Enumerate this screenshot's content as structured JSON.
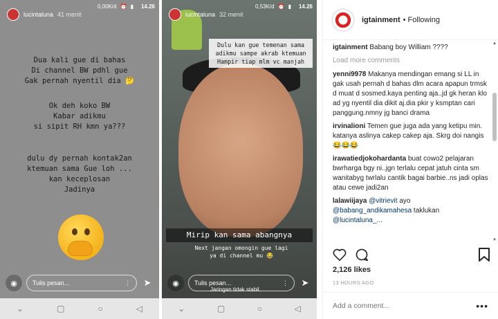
{
  "phone1": {
    "status": {
      "speed": "0,00K/d",
      "time": "14.26"
    },
    "username": "lucintaluna",
    "ago": "41 menit",
    "text_blocks": [
      "Dua kali gue di bahas\nDi channel BW pdhl gue\nGak pernah nyentil dia 🤔",
      "Ok deh koko BW\nKabar adikmu\nsi sipit RH kmn ya???",
      "dulu dy pernah kontak2an\nktemuan sama Gue loh ...\nkan keceplosan\nJadinya"
    ],
    "reply_placeholder": "Tulis pesan..."
  },
  "phone2": {
    "status": {
      "speed": "0,53K/d",
      "time": "14.26"
    },
    "username": "lucintaluna",
    "ago": "32 menit",
    "caption_top": "Dulu kan gue temenan sama\nadikmu sampe akrab ktemuan\nHampir tiap mlm vc manjah",
    "caption_mid": "Mirip kan sama abangnya",
    "caption_low": "Next jangan omongin gue lagi\nya di channel mu 😂",
    "reply_placeholder": "Tulis pesan...",
    "network_note": "Jaringan tidak stabil."
  },
  "instagram": {
    "account": "igtainment",
    "follow_state": "Following",
    "caption": {
      "user": "igtainment",
      "text": "Babang boy William ????"
    },
    "load_more": "Load more comments",
    "comments": [
      {
        "user": "yenni9978",
        "text": "Makanya mendingan emang si LL in gak usah pernah d bahas dlm acara apapun trmsk d muat d sosmed.kaya penting aja..jd gk heran klo ad yg nyentil dia dikit aj.dia pkir y ksmptan cari panggung.nmny jg banci drama"
      },
      {
        "user": "irvinalioni",
        "text": "Temen gue juga ada yang ketipu min. katanya aslinya cakep cakep aja. Skrg doi nangis 😂😂😂"
      },
      {
        "user": "irawatiedjokohardanta",
        "text": "buat cowo2 pelajaran bwrharga bgy ni..jgn terlalu cepat jatuh cinta sm wanitabyg twrlalu cantik bagai barbie..ns jadi oplas atau cewe jadi2an"
      },
      {
        "user": "lalawiijaya",
        "mention1": "@vitrievit",
        "text": "ayo",
        "mention2": "@babang_andikamahesa",
        "text2": "taklukan",
        "trail": "@lucintaluna_..."
      }
    ],
    "likes": "2,126 likes",
    "time": "13 HOURS AGO",
    "add_comment_placeholder": "Add a comment..."
  }
}
